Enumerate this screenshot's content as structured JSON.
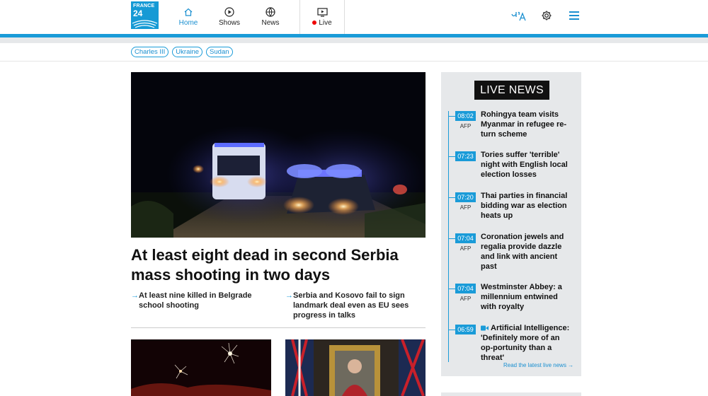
{
  "header": {
    "logo": {
      "line1": "FRANCE",
      "line2": "24"
    },
    "nav": [
      {
        "label": "Home",
        "icon": "home-icon"
      },
      {
        "label": "Shows",
        "icon": "play-circle-icon"
      },
      {
        "label": "News",
        "icon": "globe-icon"
      },
      {
        "label": "Live",
        "icon": "tv-icon"
      }
    ],
    "icons": [
      "language-icon",
      "gear-icon",
      "menu-icon"
    ]
  },
  "tags": [
    "Charles III",
    "Ukraine",
    "Sudan"
  ],
  "main_story": {
    "headline": "At least eight dead in second Serbia mass shooting in two days",
    "related": [
      "At least nine killed in Belgrade school shooting",
      "Serbia and Kosovo fail to sign landmark deal even as EU sees progress in talks"
    ]
  },
  "live_news": {
    "title": "LIVE NEWS",
    "items": [
      {
        "time": "08:02",
        "source": "AFP",
        "text": "Rohingya team visits Myanmar in refugee re-turn scheme"
      },
      {
        "time": "07:23",
        "source": "",
        "text": "Tories suffer 'terrible' night with English local election losses"
      },
      {
        "time": "07:20",
        "source": "AFP",
        "text": "Thai parties in financial bidding war as election heats up"
      },
      {
        "time": "07:04",
        "source": "AFP",
        "text": "Coronation jewels and regalia provide dazzle and link with ancient past"
      },
      {
        "time": "07:04",
        "source": "AFP",
        "text": "Westminster Abbey: a millennium entwined with royalty"
      },
      {
        "time": "06:59",
        "source": "",
        "text": "Artificial Intelligence: 'Definitely more of an op-portunity than a threat'",
        "video": true
      }
    ],
    "read_latest": "Read the latest live news →"
  },
  "colors": {
    "accent": "#1a9bd8",
    "live_dot": "#e00000",
    "panel_bg": "#e6e8ea"
  }
}
